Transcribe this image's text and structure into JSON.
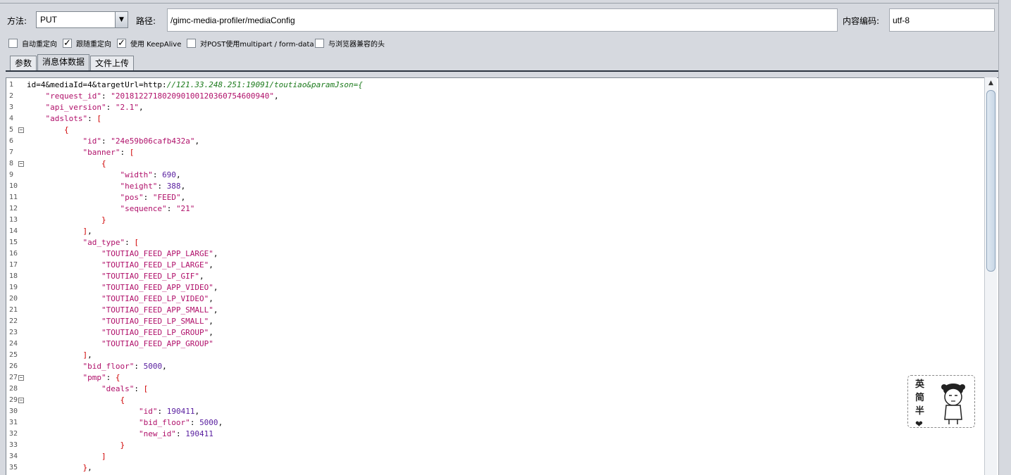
{
  "request": {
    "method_label": "方法:",
    "method_value": "PUT",
    "path_label": "路径:",
    "path_value": "/gimc-media-profiler/mediaConfig",
    "encoding_label": "内容编码:",
    "encoding_value": "utf-8"
  },
  "options": [
    {
      "label": "自动重定向",
      "checked": false
    },
    {
      "label": "跟随重定向",
      "checked": true
    },
    {
      "label": "使用 KeepAlive",
      "checked": true
    },
    {
      "label": "对POST使用multipart / form-data",
      "checked": false
    },
    {
      "label": "与浏览器兼容的头",
      "checked": false
    }
  ],
  "tabs": [
    {
      "label": "参数",
      "active": false
    },
    {
      "label": "消息体数据",
      "active": true
    },
    {
      "label": "文件上传",
      "active": false
    }
  ],
  "body": {
    "line1_prefix": "id=4&mediaId=4&targetUrl=http:",
    "line1_url": "//121.33.248.251:19091/toutiao&paramJson={",
    "lines": [
      {
        "n": "1"
      },
      {
        "n": "2"
      },
      {
        "n": "3"
      },
      {
        "n": "4"
      },
      {
        "n": "5"
      },
      {
        "n": "6"
      },
      {
        "n": "7"
      },
      {
        "n": "8"
      },
      {
        "n": "9"
      },
      {
        "n": "10"
      },
      {
        "n": "11"
      },
      {
        "n": "12"
      },
      {
        "n": "13"
      },
      {
        "n": "14"
      },
      {
        "n": "15"
      },
      {
        "n": "16"
      },
      {
        "n": "17"
      },
      {
        "n": "18"
      },
      {
        "n": "19"
      },
      {
        "n": "20"
      },
      {
        "n": "21"
      },
      {
        "n": "22"
      },
      {
        "n": "23"
      },
      {
        "n": "24"
      },
      {
        "n": "25"
      },
      {
        "n": "26"
      },
      {
        "n": "27"
      },
      {
        "n": "28"
      },
      {
        "n": "29"
      },
      {
        "n": "30"
      },
      {
        "n": "31"
      },
      {
        "n": "32"
      },
      {
        "n": "33"
      },
      {
        "n": "34"
      },
      {
        "n": "35"
      }
    ],
    "request_id": "\"20181227180209010012036075460094 0\"",
    "text": {
      "l2": "    \"request_id\": \"2018122718020901001203607546009 40\",",
      "l3": "    \"api_version\": \"2.1\",",
      "l4": "    \"adslots\": [",
      "l5": "        {",
      "l6": "            \"id\": \"24e59b06cafb432a\",",
      "l7": "            \"banner\": [",
      "l8": "                {",
      "l9": "                    \"width\": 690,",
      "l10": "                    \"height\": 388,",
      "l11": "                    \"pos\": \"FEED\",",
      "l12": "                    \"sequence\": \"21\"",
      "l13": "                }",
      "l14": "            ],",
      "l15": "            \"ad_type\": [",
      "l16": "                \"TOUTIAO_FEED_APP_LARGE\",",
      "l17": "                \"TOUTIAO_FEED_LP_LARGE\",",
      "l18": "                \"TOUTIAO_FEED_LP_GIF\",",
      "l19": "                \"TOUTIAO_FEED_APP_VIDEO\",",
      "l20": "                \"TOUTIAO_FEED_LP_VIDEO\",",
      "l21": "                \"TOUTIAO_FEED_APP_SMALL\",",
      "l22": "                \"TOUTIAO_FEED_LP_SMALL\",",
      "l23": "                \"TOUTIAO_FEED_LP_GROUP\",",
      "l24": "                \"TOUTIAO_FEED_APP_GROUP\"",
      "l25": "            ],",
      "l26": "            \"bid_floor\": 5000,",
      "l27": "            \"pmp\": {",
      "l28": "                \"deals\": [",
      "l29": "                    {",
      "l30": "                        \"id\": 190411,",
      "l31": "                        \"bid_floor\": 5000,",
      "l32": "                        \"new_id\": 190411",
      "l33": "                    }",
      "l34": "                ]",
      "l35": "            },"
    }
  },
  "ime_widget": {
    "chars": [
      "英",
      "简",
      "半",
      "❤"
    ]
  }
}
